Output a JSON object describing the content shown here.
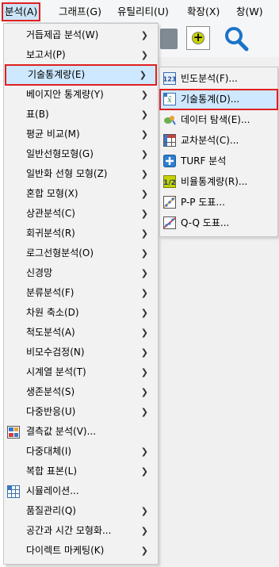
{
  "menubar": {
    "items": [
      {
        "label": "분석(A)",
        "active": true
      },
      {
        "label": "그래프(G)"
      },
      {
        "label": "유틸리티(U)"
      },
      {
        "label": "확장(X)"
      },
      {
        "label": "창(W)"
      }
    ]
  },
  "analyze_menu": {
    "items": [
      {
        "label": "거듭제곱 분석(W)",
        "submenu": true
      },
      {
        "label": "보고서(P)",
        "submenu": true
      },
      {
        "label": "기술통계량(E)",
        "submenu": true,
        "selected": true
      },
      {
        "label": "베이지안 통계량(Y)",
        "submenu": true
      },
      {
        "label": "표(B)",
        "submenu": true
      },
      {
        "label": "평균 비교(M)",
        "submenu": true
      },
      {
        "label": "일반선형모형(G)",
        "submenu": true
      },
      {
        "label": "일반화 선형 모형(Z)",
        "submenu": true
      },
      {
        "label": "혼합 모형(X)",
        "submenu": true
      },
      {
        "label": "상관분석(C)",
        "submenu": true
      },
      {
        "label": "회귀분석(R)",
        "submenu": true
      },
      {
        "label": "로그선형분석(O)",
        "submenu": true
      },
      {
        "label": "신경망",
        "submenu": true
      },
      {
        "label": "분류분석(F)",
        "submenu": true
      },
      {
        "label": "차원 축소(D)",
        "submenu": true
      },
      {
        "label": "척도분석(A)",
        "submenu": true
      },
      {
        "label": "비모수검정(N)",
        "submenu": true
      },
      {
        "label": "시계열 분석(T)",
        "submenu": true
      },
      {
        "label": "생존분석(S)",
        "submenu": true
      },
      {
        "label": "다중반응(U)",
        "submenu": true
      },
      {
        "label": "결측값 분석(V)...",
        "icon": "missing-values-icon"
      },
      {
        "label": "다중대체(I)",
        "submenu": true
      },
      {
        "label": "복합 표본(L)",
        "submenu": true
      },
      {
        "label": "시뮬레이션...",
        "icon": "simulation-icon"
      },
      {
        "label": "품질관리(Q)",
        "submenu": true
      },
      {
        "label": "공간과 시간 모형화...",
        "submenu": true
      },
      {
        "label": "다이렉트 마케팅(K)",
        "submenu": true
      }
    ]
  },
  "descriptives_submenu": {
    "items": [
      {
        "label": "빈도분석(F)...",
        "icon": "frequencies-icon"
      },
      {
        "label": "기술통계(D)...",
        "icon": "descriptives-icon",
        "selected": true
      },
      {
        "label": "데이터 탐색(E)...",
        "icon": "explore-icon"
      },
      {
        "label": "교차분석(C)...",
        "icon": "crosstabs-icon"
      },
      {
        "label": "TURF 분석",
        "icon": "turf-icon"
      },
      {
        "label": "비율통계량(R)...",
        "icon": "ratio-icon"
      },
      {
        "label": "P-P 도표...",
        "icon": "pp-plot-icon"
      },
      {
        "label": "Q-Q 도표...",
        "icon": "qq-plot-icon"
      }
    ]
  },
  "colors": {
    "highlight": "#cde8ff",
    "outline": "#e02020"
  }
}
